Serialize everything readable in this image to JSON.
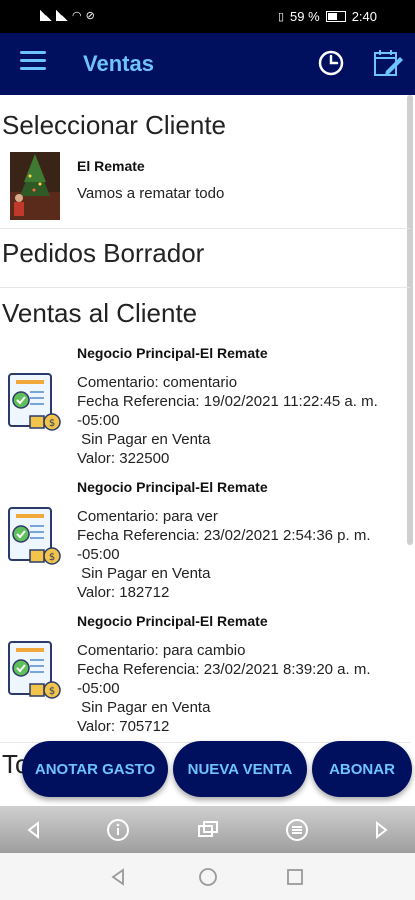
{
  "status_bar": {
    "battery": "59 %",
    "time": "2:40"
  },
  "app_bar": {
    "title": "Ventas",
    "menu_icon": "menu-icon",
    "history_icon": "clock-icon",
    "calendar_icon": "calendar-edit-icon"
  },
  "sections": {
    "client": "Seleccionar Cliente",
    "drafts": "Pedidos Borrador",
    "sales": "Ventas al Cliente",
    "partial_next": "To"
  },
  "client": {
    "name": "El Remate",
    "description": "Vamos a rematar todo"
  },
  "sales": [
    {
      "title": "Negocio Principal-El Remate",
      "comment": "Comentario: comentario",
      "date": "Fecha Referencia: 19/02/2021 11:22:45 a. m.",
      "tz": "-05:00",
      "status": " Sin Pagar en Venta",
      "value": "Valor: 322500"
    },
    {
      "title": "Negocio Principal-El Remate",
      "comment": "Comentario: para ver",
      "date": "Fecha Referencia: 23/02/2021 2:54:36 p. m.",
      "tz": "-05:00",
      "status": " Sin Pagar en Venta",
      "value": "Valor: 182712"
    },
    {
      "title": "Negocio Principal-El Remate",
      "comment": "Comentario: para cambio",
      "date": "Fecha Referencia: 23/02/2021 8:39:20 a. m.",
      "tz": "-05:00",
      "status": " Sin Pagar en Venta",
      "value": "Valor: 705712"
    }
  ],
  "actions": {
    "expense": "ANOTAR GASTO",
    "new_sale": "NUEVA VENTA",
    "pay": "ABONAR"
  },
  "colors": {
    "app_bar": "#00105f",
    "accent": "#6ec3ff"
  }
}
